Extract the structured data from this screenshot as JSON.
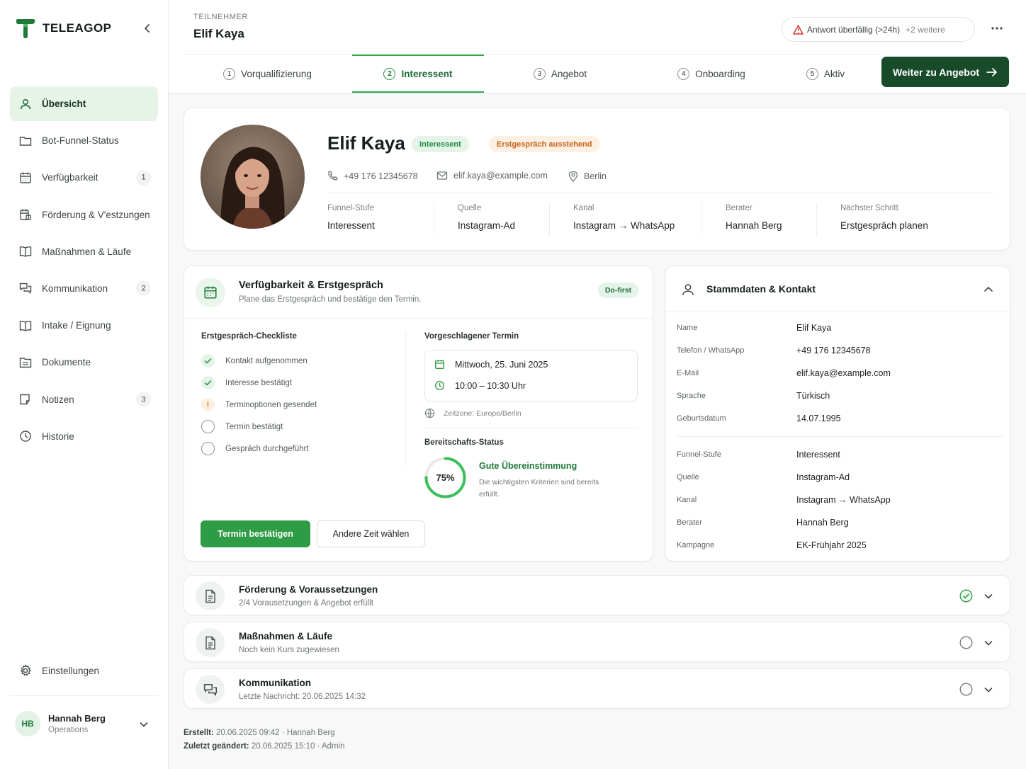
{
  "sidebar": {
    "logo_text": "TELEAGOP",
    "nav": [
      {
        "label": "Übersicht",
        "icon": "user-icon",
        "badge": "",
        "active": true
      },
      {
        "label": "Bot-Funnel-Status",
        "icon": "folder-icon",
        "badge": ""
      },
      {
        "label": "Verfügbarkeit",
        "icon": "calendar-icon",
        "badge": "1"
      },
      {
        "label": "Förderung & V'estzungen",
        "icon": "calendar-doc-icon",
        "badge": ""
      },
      {
        "label": "Maßnahmen & Läufe",
        "icon": "book-icon",
        "badge": ""
      },
      {
        "label": "Kommunikation",
        "icon": "chat-icon",
        "badge": "2"
      },
      {
        "label": "Intake / Eignung",
        "icon": "book-icon",
        "badge": ""
      },
      {
        "label": "Dokumente",
        "icon": "folder-doc-icon",
        "badge": ""
      },
      {
        "label": "Notizen",
        "icon": "note-icon",
        "badge": "3"
      },
      {
        "label": "Historie",
        "icon": "clock-icon",
        "badge": ""
      }
    ],
    "settings_label": "Einstellungen",
    "user": {
      "initials": "HB",
      "name": "Hannah Berg",
      "role": "Operations"
    }
  },
  "header": {
    "breadcrumb": "TEILNEHMER",
    "title": "Elif Kaya",
    "alert": "Antwort überfällig (>24h)",
    "alert_more": "+2 weitere",
    "cta_label": "Weiter zu Angebot"
  },
  "steps": [
    {
      "num": "1",
      "label": "Vorqualifizierung"
    },
    {
      "num": "2",
      "label": "Interessent",
      "active": true
    },
    {
      "num": "3",
      "label": "Angebot"
    },
    {
      "num": "4",
      "label": "Onboarding"
    },
    {
      "num": "5",
      "label": "Aktiv"
    }
  ],
  "profile": {
    "name": "Elif Kaya",
    "tag_stage": "Interessent",
    "tag_status": "Erstgespräch ausstehend",
    "phone": "+49 176 12345678",
    "email": "elif.kaya@example.com",
    "city": "Berlin",
    "meta": [
      {
        "label": "Funnel-Stufe",
        "value": "Interessent"
      },
      {
        "label": "Quelle",
        "value": "Instagram-Ad"
      },
      {
        "label": "Kanal",
        "value": "Instagram → WhatsApp"
      },
      {
        "label": "Berater",
        "value": "Hannah Berg"
      },
      {
        "label": "Nächster Schritt",
        "value": "Erstgespräch planen"
      }
    ]
  },
  "availability": {
    "title": "Verfügbarkeit & Erstgespräch",
    "subtitle": "Plane das Erstgespräch und bestätige den Termin.",
    "badge": "Do-first",
    "checklist_title": "Erstgespräch-Checkliste",
    "checklist": [
      {
        "label": "Kontakt aufgenommen",
        "state": "done"
      },
      {
        "label": "Interesse bestätigt",
        "state": "done"
      },
      {
        "label": "Terminoptionen gesendet",
        "state": "warn"
      },
      {
        "label": "Termin bestätigt",
        "state": "open"
      },
      {
        "label": "Gespräch durchgeführt",
        "state": "open"
      }
    ],
    "proposed_title": "Vorgeschlagener Termin",
    "date": "Mittwoch, 25. Juni 2025",
    "time": "10:00 – 10:30 Uhr",
    "timezone": "Zeitzone: Europe/Berlin",
    "readiness_title": "Bereitschafts-Status",
    "readiness_percent": 75,
    "readiness_label": "75%",
    "readiness_heading": "Gute Übereinstimmung",
    "readiness_desc": "Die wichtigsten Kriterien sind bereits erfüllt.",
    "btn_confirm": "Termin bestätigen",
    "btn_other": "Andere Zeit wählen"
  },
  "stammdaten": {
    "title": "Stammdaten & Kontakt",
    "fields": [
      {
        "k": "Name",
        "v": "Elif Kaya"
      },
      {
        "k": "Telefon / WhatsApp",
        "v": "+49 176 12345678"
      },
      {
        "k": "E-Mail",
        "v": "elif.kaya@example.com"
      },
      {
        "k": "Sprache",
        "v": "Türkisch"
      },
      {
        "k": "Geburtsdatum",
        "v": "14.07.1995"
      }
    ],
    "fields2": [
      {
        "k": "Funnel-Stufe",
        "v": "Interessent"
      },
      {
        "k": "Quelle",
        "v": "Instagram-Ad"
      },
      {
        "k": "Kanal",
        "v": "Instagram → WhatsApp"
      },
      {
        "k": "Berater",
        "v": "Hannah Berg"
      },
      {
        "k": "Kampagne",
        "v": "EK-Frühjahr 2025"
      }
    ]
  },
  "accordions": [
    {
      "title": "Förderung & Voraussetzungen",
      "sub": "2/4 Vorausetzungen & Angebot erfüllt",
      "state": "done"
    },
    {
      "title": "Maßnahmen & Läufe",
      "sub": "Noch kein Kurs zugewiesen",
      "state": "open"
    },
    {
      "title": "Kommunikation",
      "sub": "Letzte Nachricht: 20.06.2025 14:32",
      "state": "open"
    }
  ],
  "footer": {
    "created_label": "Erstellt:",
    "created_value": "20.06.2025 09:42",
    "created_by": "Hannah Berg",
    "changed_label": "Zuletzt geändert:",
    "changed_value": "20.06.2025 15:10",
    "changed_by": "Admin",
    "separator": "·"
  },
  "colors": {
    "accent": "#2e9b45",
    "dark_green": "#174b2a",
    "warn": "#d9731f",
    "alert_red": "#d9342b"
  }
}
